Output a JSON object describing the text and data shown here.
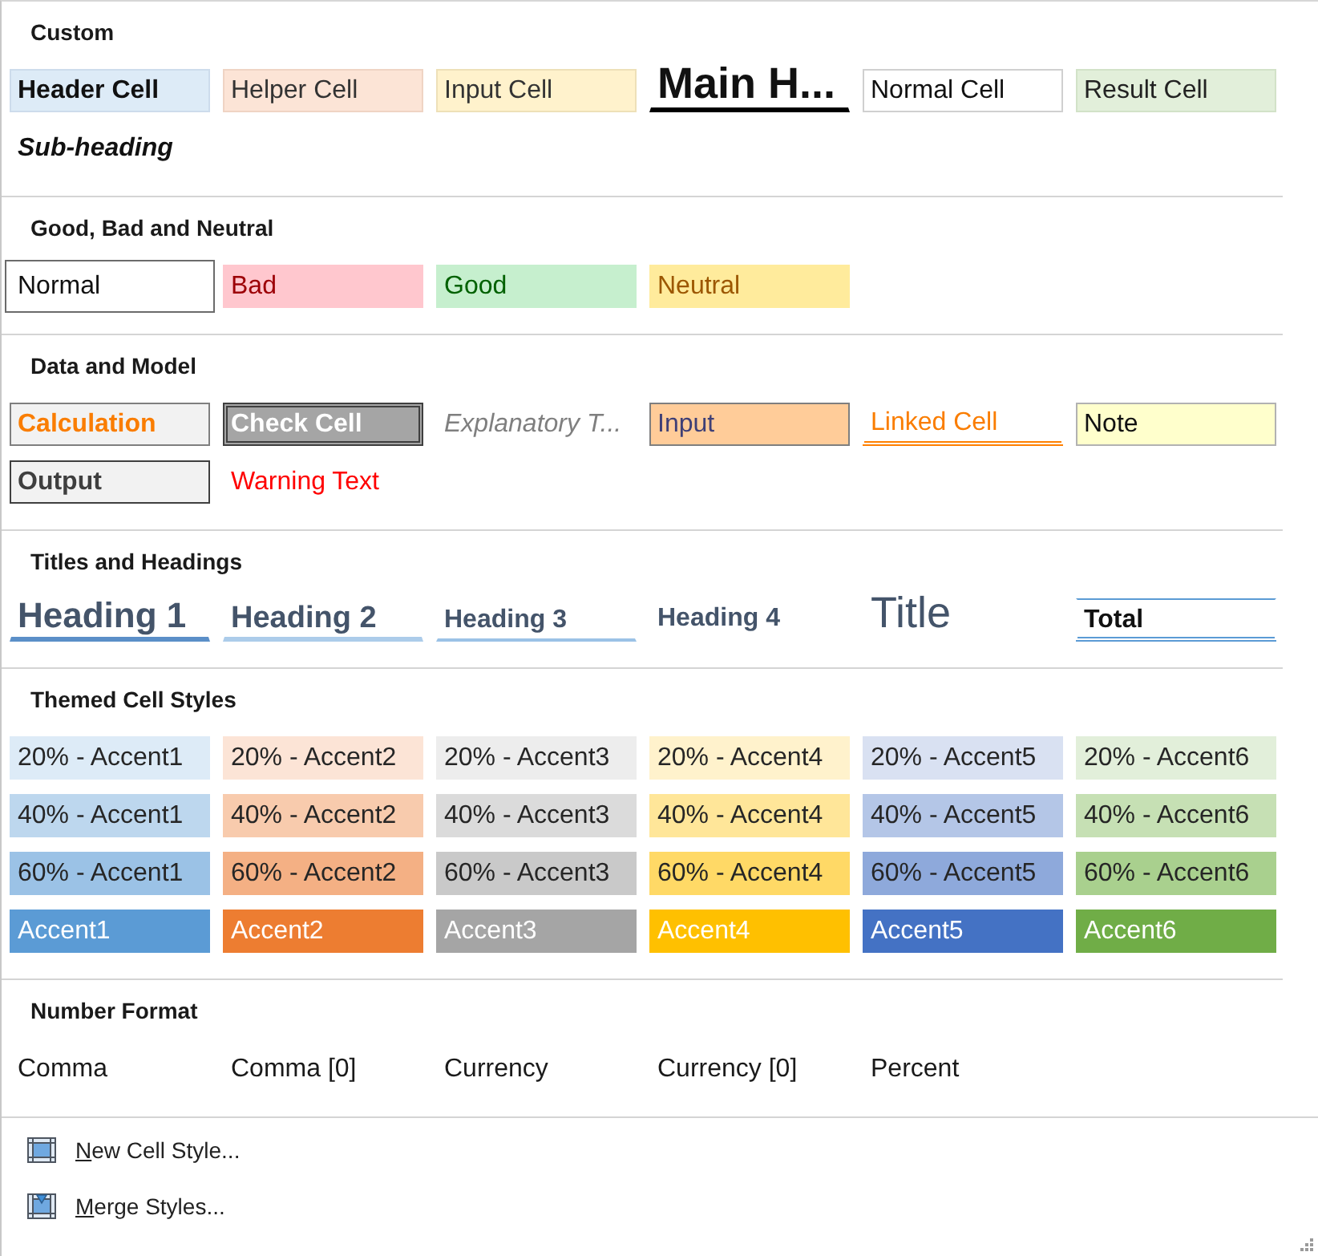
{
  "sections": [
    {
      "title": "Custom",
      "items": [
        {
          "label": "Header Cell",
          "kind": "header",
          "selected": false
        },
        {
          "label": "Helper Cell",
          "kind": "helper",
          "selected": false
        },
        {
          "label": "Input Cell",
          "kind": "input-cell",
          "selected": false
        },
        {
          "label": "Main H...",
          "kind": "main-heading",
          "selected": false
        },
        {
          "label": "Normal Cell",
          "kind": "normal-cell",
          "selected": false
        },
        {
          "label": "Result Cell",
          "kind": "result",
          "selected": false
        },
        {
          "label": "Sub-heading",
          "kind": "sub-heading",
          "selected": false
        }
      ]
    },
    {
      "title": "Good, Bad and Neutral",
      "items": [
        {
          "label": "Normal",
          "kind": "normal",
          "selected": true
        },
        {
          "label": "Bad",
          "kind": "bad",
          "selected": false
        },
        {
          "label": "Good",
          "kind": "good",
          "selected": false
        },
        {
          "label": "Neutral",
          "kind": "neutral",
          "selected": false
        }
      ]
    },
    {
      "title": "Data and Model",
      "items": [
        {
          "label": "Calculation",
          "kind": "calculation",
          "selected": false
        },
        {
          "label": "Check Cell",
          "kind": "check",
          "selected": false
        },
        {
          "label": "Explanatory T...",
          "kind": "explanatory",
          "selected": false
        },
        {
          "label": "Input",
          "kind": "input",
          "selected": false
        },
        {
          "label": "Linked Cell",
          "kind": "linked",
          "selected": false
        },
        {
          "label": "Note",
          "kind": "note",
          "selected": false
        },
        {
          "label": "Output",
          "kind": "output",
          "selected": false
        },
        {
          "label": "Warning Text",
          "kind": "warning",
          "selected": false
        }
      ]
    },
    {
      "title": "Titles and Headings",
      "items": [
        {
          "label": "Heading 1",
          "kind": "heading-1",
          "selected": false
        },
        {
          "label": "Heading 2",
          "kind": "heading-2",
          "selected": false
        },
        {
          "label": "Heading 3",
          "kind": "heading-3",
          "selected": false
        },
        {
          "label": "Heading 4",
          "kind": "heading-4",
          "selected": false
        },
        {
          "label": "Title",
          "kind": "title",
          "selected": false
        },
        {
          "label": "Total",
          "kind": "total",
          "selected": false
        }
      ]
    },
    {
      "title": "Themed Cell Styles",
      "items": [
        {
          "label": "20% - Accent1",
          "kind": "tint",
          "color": "#ddebf7",
          "selected": false
        },
        {
          "label": "20% - Accent2",
          "kind": "tint",
          "color": "#fce4d6",
          "selected": false
        },
        {
          "label": "20% - Accent3",
          "kind": "tint",
          "color": "#ededed",
          "selected": false
        },
        {
          "label": "20% - Accent4",
          "kind": "tint",
          "color": "#fff2cc",
          "selected": false
        },
        {
          "label": "20% - Accent5",
          "kind": "tint",
          "color": "#d9e1f2",
          "selected": false
        },
        {
          "label": "20% - Accent6",
          "kind": "tint",
          "color": "#e2efda",
          "selected": false
        },
        {
          "label": "40% - Accent1",
          "kind": "tint",
          "color": "#bdd7ee",
          "selected": false
        },
        {
          "label": "40% - Accent2",
          "kind": "tint",
          "color": "#f8cbad",
          "selected": false
        },
        {
          "label": "40% - Accent3",
          "kind": "tint",
          "color": "#dbdbdb",
          "selected": false
        },
        {
          "label": "40% - Accent4",
          "kind": "tint",
          "color": "#ffe699",
          "selected": false
        },
        {
          "label": "40% - Accent5",
          "kind": "tint",
          "color": "#b4c6e7",
          "selected": false
        },
        {
          "label": "40% - Accent6",
          "kind": "tint",
          "color": "#c6e0b4",
          "selected": false
        },
        {
          "label": "60% - Accent1",
          "kind": "tint",
          "color": "#9bc2e6",
          "selected": false
        },
        {
          "label": "60% - Accent2",
          "kind": "tint",
          "color": "#f4b084",
          "selected": false
        },
        {
          "label": "60% - Accent3",
          "kind": "tint",
          "color": "#c9c9c9",
          "selected": false
        },
        {
          "label": "60% - Accent4",
          "kind": "tint",
          "color": "#ffd966",
          "selected": false
        },
        {
          "label": "60% - Accent5",
          "kind": "tint",
          "color": "#8ea9db",
          "selected": false
        },
        {
          "label": "60% - Accent6",
          "kind": "tint",
          "color": "#a9d08e",
          "selected": false
        },
        {
          "label": "Accent1",
          "kind": "accent",
          "color": "#5b9bd5",
          "selected": false
        },
        {
          "label": "Accent2",
          "kind": "accent",
          "color": "#ed7d31",
          "selected": false
        },
        {
          "label": "Accent3",
          "kind": "accent",
          "color": "#a5a5a5",
          "selected": false
        },
        {
          "label": "Accent4",
          "kind": "accent",
          "color": "#ffc000",
          "selected": false
        },
        {
          "label": "Accent5",
          "kind": "accent",
          "color": "#4472c4",
          "selected": false
        },
        {
          "label": "Accent6",
          "kind": "accent",
          "color": "#70ad47",
          "selected": false
        }
      ]
    },
    {
      "title": "Number Format",
      "items": [
        {
          "label": "Comma",
          "kind": "number",
          "selected": false
        },
        {
          "label": "Comma [0]",
          "kind": "number",
          "selected": false
        },
        {
          "label": "Currency",
          "kind": "number",
          "selected": false
        },
        {
          "label": "Currency [0]",
          "kind": "number",
          "selected": false
        },
        {
          "label": "Percent",
          "kind": "number",
          "selected": false
        }
      ]
    }
  ],
  "menu": [
    {
      "label": "New Cell Style...",
      "kind": "new"
    },
    {
      "label": "Merge Styles...",
      "kind": "merge"
    }
  ]
}
